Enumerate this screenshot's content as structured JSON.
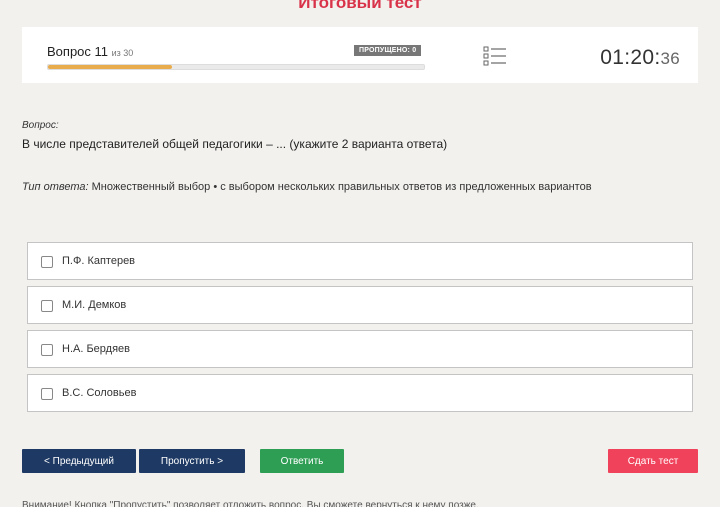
{
  "page": {
    "title": "Итоговый тест"
  },
  "status": {
    "question_label": "Вопрос 11",
    "of_label": "из 30",
    "skipped_badge": "ПРОПУЩЕНО: 0",
    "progress_fraction": 0.33,
    "timer_main": "01:20",
    "timer_seconds": "36",
    "icons": {
      "list": "question-list-icon"
    },
    "colors": {
      "progress": "#e9ac4c",
      "title": "#d9334a"
    }
  },
  "question": {
    "label": "Вопрос:",
    "text": "В числе представителей общей педагогики – ... (укажите 2 варианта ответа)",
    "type_label": "Тип ответа:",
    "type_text": " Множественный выбор • с выбором нескольких правильных ответов из предложенных вариантов"
  },
  "options": [
    {
      "label": "П.Ф. Каптерев",
      "checked": false
    },
    {
      "label": "М.И. Демков",
      "checked": false
    },
    {
      "label": "Н.А. Бердяев",
      "checked": false
    },
    {
      "label": "В.С. Соловьев",
      "checked": false
    }
  ],
  "buttons": {
    "prev": "< Предыдущий",
    "skip": "Пропустить >",
    "answer": "Ответить",
    "submit": "Сдать тест",
    "colors": {
      "prev": "#1e3a64",
      "skip": "#1e3a64",
      "answer": "#2e9e54",
      "submit": "#f0435b"
    }
  },
  "footer": {
    "text": "Внимание! Кнопка \"Пропустить\" позволяет отложить вопрос. Вы сможете вернуться к нему позже."
  }
}
